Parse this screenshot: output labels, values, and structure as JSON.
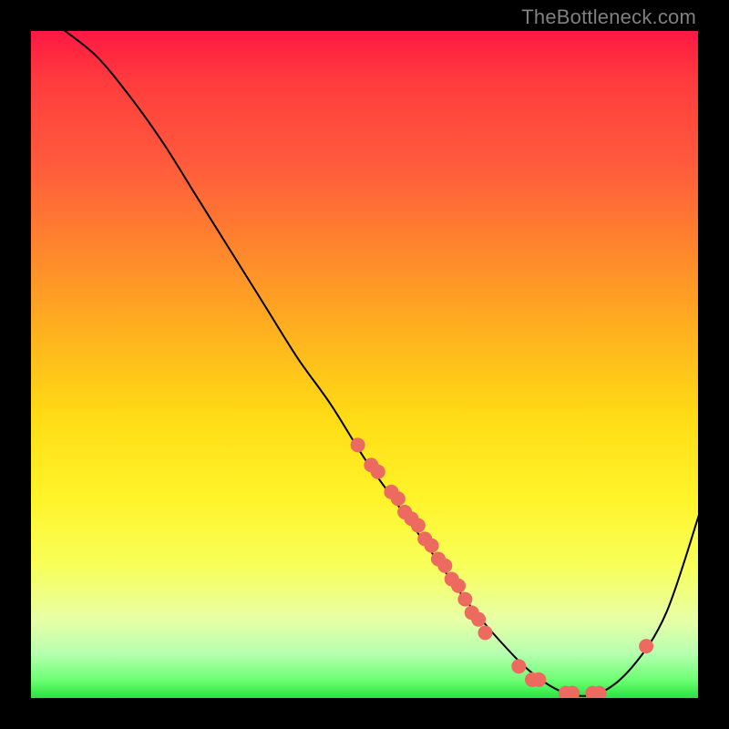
{
  "attribution": "TheBottleneck.com",
  "chart_data": {
    "type": "line",
    "title": "",
    "xlabel": "",
    "ylabel": "",
    "xlim": [
      0,
      100
    ],
    "ylim": [
      0,
      100
    ],
    "grid": false,
    "legend": false,
    "background_gradient": {
      "direction": "vertical",
      "stops": [
        {
          "pos": 0.0,
          "color": "#ff1744"
        },
        {
          "pos": 0.2,
          "color": "#ff5a3c"
        },
        {
          "pos": 0.46,
          "color": "#ffb41e"
        },
        {
          "pos": 0.7,
          "color": "#fff42a"
        },
        {
          "pos": 0.88,
          "color": "#e8ffa6"
        },
        {
          "pos": 1.0,
          "color": "#22e03a"
        }
      ]
    },
    "series": [
      {
        "name": "bottleneck-curve",
        "color": "#000000",
        "width": 2,
        "x": [
          5,
          10,
          15,
          20,
          25,
          30,
          35,
          40,
          45,
          50,
          55,
          60,
          65,
          70,
          75,
          80,
          85,
          90,
          95,
          100
        ],
        "y": [
          100,
          96,
          90,
          83,
          75,
          67,
          59,
          51,
          44,
          36,
          29,
          22,
          15,
          9,
          4,
          1,
          1,
          5,
          13,
          28
        ]
      }
    ],
    "markers": {
      "name": "data-points",
      "color": "#ec6a5f",
      "radius": 8,
      "points": [
        {
          "x": 49,
          "y": 38
        },
        {
          "x": 51,
          "y": 35
        },
        {
          "x": 52,
          "y": 34
        },
        {
          "x": 54,
          "y": 31
        },
        {
          "x": 55,
          "y": 30
        },
        {
          "x": 56,
          "y": 28
        },
        {
          "x": 57,
          "y": 27
        },
        {
          "x": 58,
          "y": 26
        },
        {
          "x": 59,
          "y": 24
        },
        {
          "x": 60,
          "y": 23
        },
        {
          "x": 61,
          "y": 21
        },
        {
          "x": 62,
          "y": 20
        },
        {
          "x": 63,
          "y": 18
        },
        {
          "x": 64,
          "y": 17
        },
        {
          "x": 65,
          "y": 15
        },
        {
          "x": 66,
          "y": 13
        },
        {
          "x": 67,
          "y": 12
        },
        {
          "x": 68,
          "y": 10
        },
        {
          "x": 73,
          "y": 5
        },
        {
          "x": 75,
          "y": 3
        },
        {
          "x": 76,
          "y": 3
        },
        {
          "x": 80,
          "y": 1
        },
        {
          "x": 81,
          "y": 1
        },
        {
          "x": 84,
          "y": 1
        },
        {
          "x": 85,
          "y": 1
        },
        {
          "x": 92,
          "y": 8
        }
      ]
    }
  }
}
